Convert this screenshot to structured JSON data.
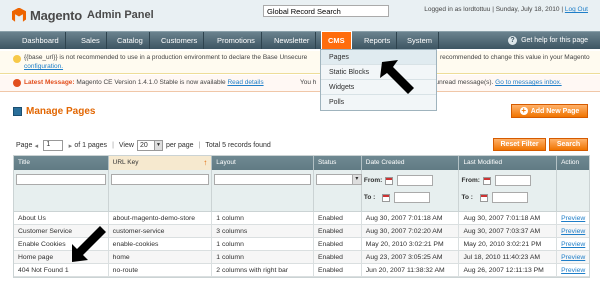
{
  "header": {
    "logo_text": "Magento",
    "logo_sub": "Admin Panel",
    "search_value": "Global Record Search",
    "user_text": "Logged in as lordtottuu | Sunday, July 18, 2010 |",
    "logout": "Log Out"
  },
  "nav": {
    "items": [
      "Dashboard",
      "Sales",
      "Catalog",
      "Customers",
      "Promotions",
      "Newsletter",
      "CMS",
      "Reports",
      "System"
    ],
    "help": "Get help for this page"
  },
  "cms_menu": [
    "Pages",
    "Static Blocks",
    "Widgets",
    "Polls"
  ],
  "messages": {
    "notice_start": "{{base_url}} is not recommended to use in a production environment to declare the Base Unsecure",
    "notice_end": "recommended to change this value in your Magento",
    "notice_link": "configuration.",
    "latest_label": "Latest Message:",
    "latest_text": "Magento CE Version 1.4.1.0 Stable is now available",
    "latest_link": "Read details",
    "mid_text": "You h",
    "notice_unread": "otice unread message(s).",
    "inbox_link": "Go to messages inbox."
  },
  "page": {
    "title": "Manage Pages",
    "add_button": "Add New Page"
  },
  "pager": {
    "page_label": "Page",
    "page_value": "1",
    "of_pages": "of 1 pages",
    "view_label": "View",
    "view_value": "20",
    "per_page": "per page",
    "total": "Total 5 records found",
    "reset": "Reset Filter",
    "search": "Search"
  },
  "grid": {
    "columns": [
      "Title",
      "URL Key",
      "Layout",
      "Status",
      "Date Created",
      "Last Modified",
      "Action"
    ],
    "from": "From:",
    "to": "To :",
    "rows": [
      [
        "About Us",
        "about-magento-demo-store",
        "1 column",
        "Enabled",
        "Aug 30, 2007 7:01:18 AM",
        "Aug 30, 2007 7:01:18 AM",
        "Preview"
      ],
      [
        "Customer Service",
        "customer-service",
        "3 columns",
        "Enabled",
        "Aug 30, 2007 7:02:20 AM",
        "Aug 30, 2007 7:03:37 AM",
        "Preview"
      ],
      [
        "Enable Cookies",
        "enable-cookies",
        "1 column",
        "Enabled",
        "May 20, 2010 3:02:21 PM",
        "May 20, 2010 3:02:21 PM",
        "Preview"
      ],
      [
        "Home page",
        "home",
        "1 column",
        "Enabled",
        "Aug 23, 2007 3:05:25 AM",
        "Jul 18, 2010 11:40:23 AM",
        "Preview"
      ],
      [
        "404 Not Found 1",
        "no-route",
        "2 columns with right bar",
        "Enabled",
        "Jun 20, 2007 11:38:32 AM",
        "Aug 26, 2007 12:11:13 PM",
        "Preview"
      ]
    ]
  }
}
